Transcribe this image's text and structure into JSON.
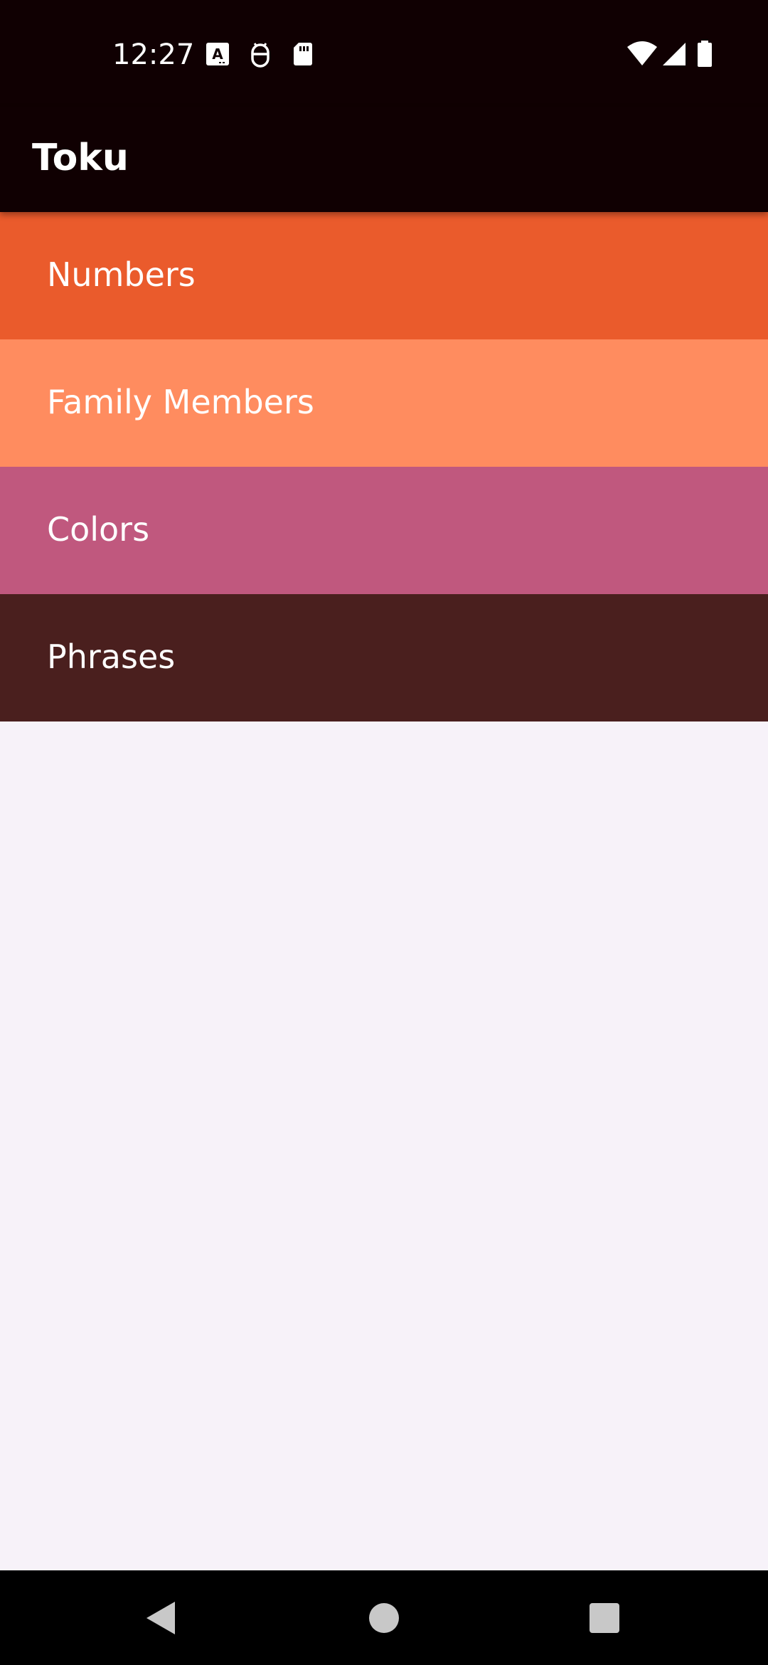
{
  "status_bar": {
    "time": "12:27",
    "icons": [
      "keyboard-a-icon",
      "android-debug-icon",
      "sd-card-icon",
      "wifi-icon",
      "cellular-signal-icon",
      "battery-icon"
    ]
  },
  "app_bar": {
    "title": "Toku"
  },
  "categories": [
    {
      "label": "Numbers",
      "color": "#ea5b2c"
    },
    {
      "label": "Family Members",
      "color": "#ff8c5f"
    },
    {
      "label": "Colors",
      "color": "#c0587e"
    },
    {
      "label": "Phrases",
      "color": "#4a1f1e"
    }
  ],
  "colors": {
    "status_bar_bg": "#100002",
    "app_bar_bg": "#100002",
    "body_bg": "#f7f2f9",
    "nav_bar_bg": "#000000",
    "nav_icon": "#c8c8c8"
  },
  "nav_bar": {
    "icons": [
      "back-icon",
      "home-icon",
      "recents-icon"
    ]
  }
}
